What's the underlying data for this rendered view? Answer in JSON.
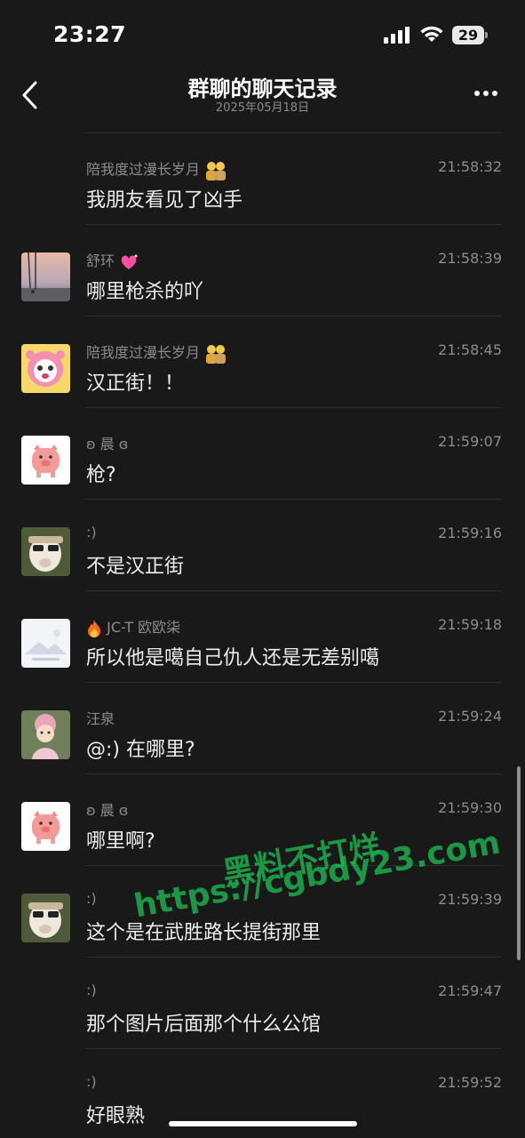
{
  "status_bar": {
    "time": "23:27",
    "battery": "29"
  },
  "nav": {
    "title": "群聊的聊天记录",
    "subtitle": "2025年05月18日"
  },
  "messages": [
    {
      "sender": "陪我度过漫长岁月",
      "time": "21:58:32",
      "text": "我朋友看见了凶手",
      "avatar": "none"
    },
    {
      "sender": "舒环",
      "time": "21:58:39",
      "text": "哪里枪杀的吖",
      "avatar": "sunset-photo"
    },
    {
      "sender": "陪我度过漫长岁月",
      "time": "21:58:45",
      "text": "汉正街！！",
      "avatar": "pink-cartoon"
    },
    {
      "sender": "ʚ 晨 ɞ",
      "time": "21:59:07",
      "text": "枪?",
      "avatar": "pink-pig"
    },
    {
      "sender": ":)",
      "time": "21:59:16",
      "text": "不是汉正街",
      "avatar": "alpaca"
    },
    {
      "sender": "JC-T 欧欧柒",
      "time": "21:59:18",
      "text": "所以他是噶自己仇人还是无差别噶",
      "avatar": "placeholder-image"
    },
    {
      "sender": "汪泉",
      "time": "21:59:24",
      "text": "@:) 在哪里?",
      "avatar": "child-photo"
    },
    {
      "sender": "ʚ 晨 ɞ",
      "time": "21:59:30",
      "text": "哪里啊?",
      "avatar": "pink-pig"
    },
    {
      "sender": ":)",
      "time": "21:59:39",
      "text": "这个是在武胜路长提街那里",
      "avatar": "alpaca"
    },
    {
      "sender": ":)",
      "time": "21:59:47",
      "text": "那个图片后面那个什么公馆",
      "avatar": "none"
    },
    {
      "sender": ":)",
      "time": "21:59:52",
      "text": "好眼熟",
      "avatar": "none"
    }
  ],
  "watermark": {
    "line1": "黑料不打烊",
    "line2": "https://cgbdy23.com"
  },
  "colors": {
    "background": "#191919",
    "watermark": "#1db34f",
    "text": "#ececec",
    "meta": "#8c8c8c"
  }
}
